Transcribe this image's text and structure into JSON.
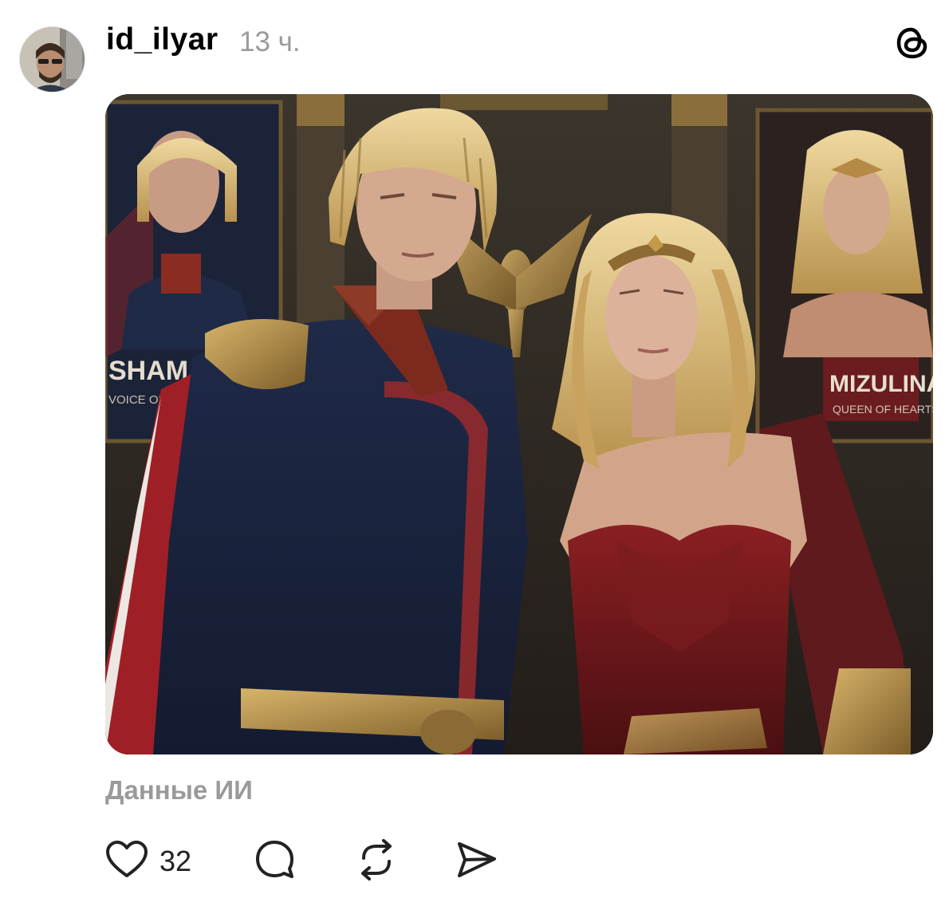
{
  "post": {
    "username": "id_ilyar",
    "time": "13 ч.",
    "ai_label": "Данные ИИ",
    "likes": "32"
  },
  "image": {
    "poster_left_name": "SHAMAN",
    "poster_left_sub": "VOICE OF RUSSIA",
    "poster_right_name": "MIZULINA",
    "poster_right_sub": "QUEEN OF HEARTS"
  },
  "icons": {
    "threads": "threads-logo-icon",
    "like": "heart-icon",
    "reply": "comment-bubble-icon",
    "repost": "repost-icon",
    "share": "send-icon"
  },
  "colors": {
    "text": "#000000",
    "muted": "#9a9a9a",
    "background": "#ffffff"
  }
}
